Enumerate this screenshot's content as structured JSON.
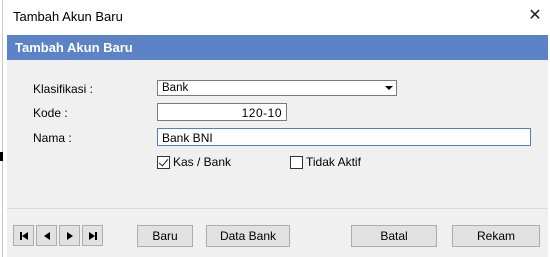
{
  "window": {
    "title": "Tambah Akun Baru",
    "close_glyph": "✕"
  },
  "header": {
    "title": "Tambah Akun Baru",
    "band_color": "#5d83c7"
  },
  "form": {
    "klasifikasi_label": "Klasifikasi :",
    "klasifikasi_value": "Bank",
    "kode_label": "Kode :",
    "kode_value": "120-10",
    "nama_label": "Nama :",
    "nama_value": "Bank BNI",
    "kas_bank_label": "Kas / Bank",
    "kas_bank_checked": true,
    "tidak_aktif_label": "Tidak Aktif",
    "tidak_aktif_checked": false
  },
  "footer": {
    "nav_icons": [
      "first-record-icon",
      "previous-record-icon",
      "next-record-icon",
      "last-record-icon"
    ],
    "baru_label": "Baru",
    "data_bank_label": "Data Bank",
    "batal_label": "Batal",
    "rekam_label": "Rekam"
  }
}
